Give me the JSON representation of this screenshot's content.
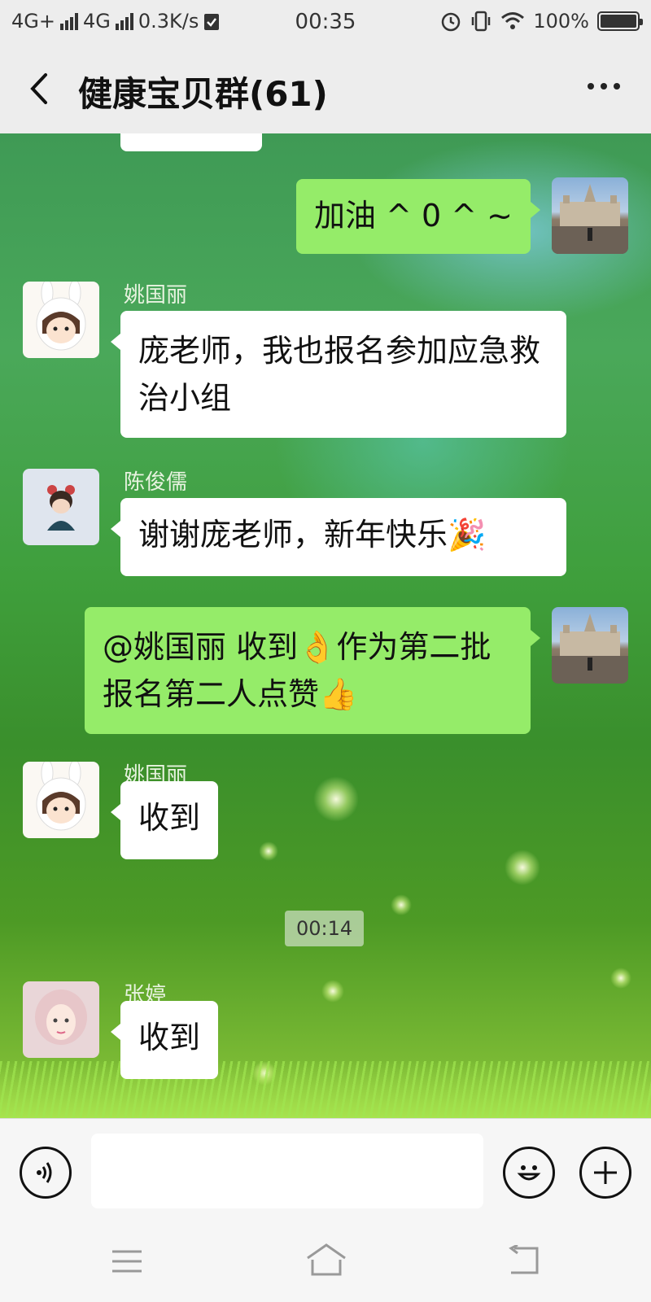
{
  "status_bar": {
    "network1": "4G+",
    "network2": "4G",
    "speed": "0.3K/s",
    "time": "00:35",
    "battery": "100%",
    "battery_level": 1.0
  },
  "header": {
    "title": "健康宝贝群(61)"
  },
  "messages": [
    {
      "side": "out",
      "text": "加油 ^ 0 ^ ~"
    },
    {
      "side": "in",
      "sender": "姚国丽",
      "text": "庞老师，我也报名参加应急救治小组"
    },
    {
      "side": "in",
      "sender": "陈俊儒",
      "text": "谢谢庞老师，新年快乐",
      "emoji": "🎉"
    },
    {
      "side": "out",
      "text_a": "@姚国丽  收到",
      "emoji_a": "👌",
      "text_b": "作为第二批报名第二人点赞",
      "emoji_b": "👍"
    },
    {
      "side": "in",
      "sender": "姚国丽",
      "text": "收到"
    },
    {
      "side": "time",
      "text": "00:14"
    },
    {
      "side": "in",
      "sender": "张婷",
      "text": "收到"
    }
  ],
  "icons": {
    "back": "chevron-left-icon",
    "more": "more-dots-icon",
    "voice": "voice-icon",
    "emoji": "smiley-icon",
    "plus": "plus-icon"
  },
  "colors": {
    "outgoing_bubble": "#95ec69",
    "incoming_bubble": "#ffffff",
    "bar_bg": "#ededed"
  }
}
